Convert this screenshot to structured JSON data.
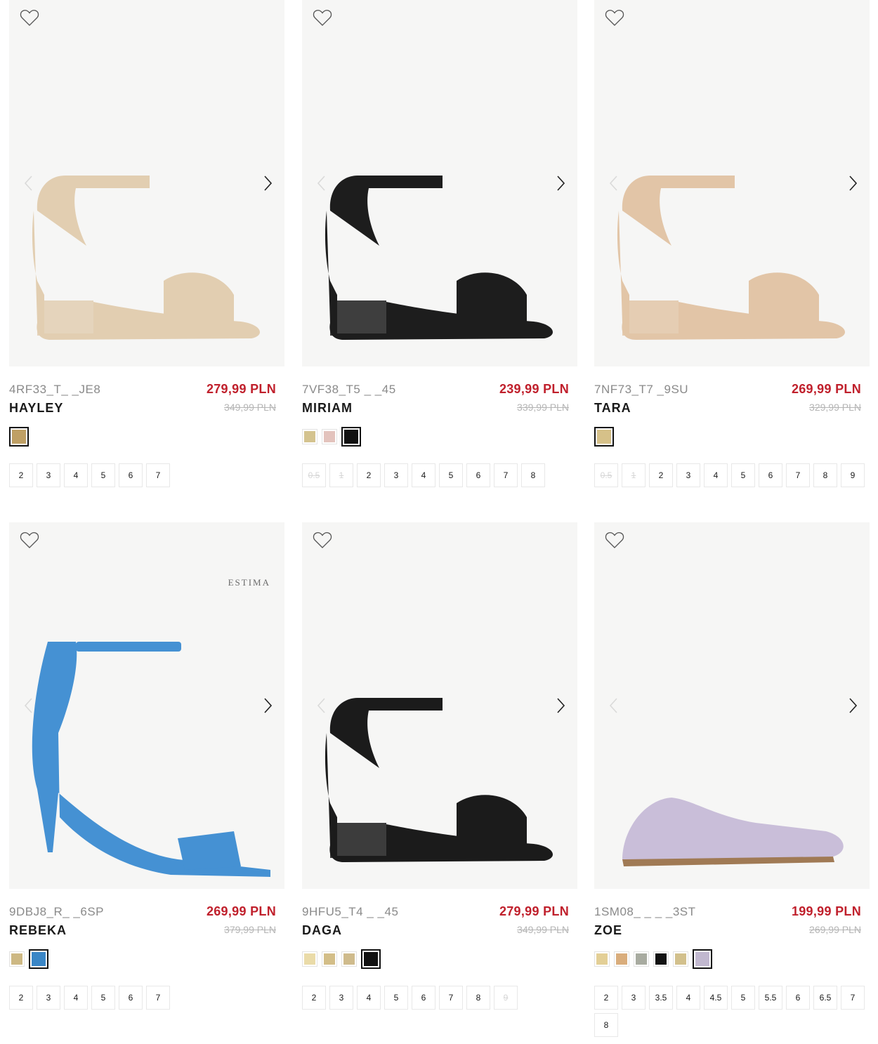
{
  "products": [
    {
      "sku": "4RF33_T_ _JE8",
      "name": "HAYLEY",
      "price": "279,99 PLN",
      "old_price": "349,99 PLN",
      "swatches": [
        {
          "color": "#bfa065",
          "selected": true
        }
      ],
      "sizes": [
        {
          "label": "2"
        },
        {
          "label": "3"
        },
        {
          "label": "4"
        },
        {
          "label": "5"
        },
        {
          "label": "6"
        },
        {
          "label": "7"
        }
      ],
      "shoe_color": "#e2ceb1",
      "watermark": ""
    },
    {
      "sku": "7VF38_T5 _ _45",
      "name": "MIRIAM",
      "price": "239,99 PLN",
      "old_price": "339,99 PLN",
      "swatches": [
        {
          "color": "#d4c38f",
          "selected": false
        },
        {
          "color": "#e3c3bd",
          "selected": false
        },
        {
          "color": "#111111",
          "selected": true
        }
      ],
      "sizes": [
        {
          "label": "0.5",
          "na": true
        },
        {
          "label": "1",
          "na": true
        },
        {
          "label": "2"
        },
        {
          "label": "3"
        },
        {
          "label": "4"
        },
        {
          "label": "5"
        },
        {
          "label": "6"
        },
        {
          "label": "7"
        },
        {
          "label": "8"
        }
      ],
      "shoe_color": "#1d1d1d",
      "watermark": ""
    },
    {
      "sku": "7NF73_T7 _9SU",
      "name": "TARA",
      "price": "269,99 PLN",
      "old_price": "329,99 PLN",
      "swatches": [
        {
          "color": "#d6c189",
          "selected": true
        }
      ],
      "sizes": [
        {
          "label": "0.5",
          "na": true
        },
        {
          "label": "1",
          "na": true
        },
        {
          "label": "2"
        },
        {
          "label": "3"
        },
        {
          "label": "4"
        },
        {
          "label": "5"
        },
        {
          "label": "6"
        },
        {
          "label": "7"
        },
        {
          "label": "8"
        },
        {
          "label": "9"
        }
      ],
      "shoe_color": "#e2c5a7",
      "watermark": ""
    },
    {
      "sku": "9DBJ8_R_ _6SP",
      "name": "REBEKA",
      "price": "269,99 PLN",
      "old_price": "379,99 PLN",
      "swatches": [
        {
          "color": "#cdb883",
          "selected": false
        },
        {
          "color": "#3a86c6",
          "selected": true
        }
      ],
      "sizes": [
        {
          "label": "2"
        },
        {
          "label": "3"
        },
        {
          "label": "4"
        },
        {
          "label": "5"
        },
        {
          "label": "6"
        },
        {
          "label": "7"
        }
      ],
      "shoe_color": "#4591d3",
      "watermark": "ESTIMA"
    },
    {
      "sku": "9HFU5_T4 _ _45",
      "name": "DAGA",
      "price": "279,99 PLN",
      "old_price": "349,99 PLN",
      "swatches": [
        {
          "color": "#eadba8",
          "selected": false
        },
        {
          "color": "#d3be88",
          "selected": false
        },
        {
          "color": "#cfbb8c",
          "selected": false
        },
        {
          "color": "#111111",
          "selected": true
        }
      ],
      "sizes": [
        {
          "label": "2"
        },
        {
          "label": "3"
        },
        {
          "label": "4"
        },
        {
          "label": "5"
        },
        {
          "label": "6"
        },
        {
          "label": "7"
        },
        {
          "label": "8"
        },
        {
          "label": "9",
          "na": true
        }
      ],
      "shoe_color": "#1b1b1b",
      "watermark": ""
    },
    {
      "sku": "1SM08_ _ _ _3ST",
      "name": "ZOE",
      "price": "199,99 PLN",
      "old_price": "269,99 PLN",
      "swatches": [
        {
          "color": "#e3cf96",
          "selected": false
        },
        {
          "color": "#d9ad7c",
          "selected": false
        },
        {
          "color": "#a8aba0",
          "selected": false
        },
        {
          "color": "#121212",
          "selected": false
        },
        {
          "color": "#d2c08c",
          "selected": false
        },
        {
          "color": "#c1b8cf",
          "selected": true
        }
      ],
      "sizes": [
        {
          "label": "2"
        },
        {
          "label": "3"
        },
        {
          "label": "3.5"
        },
        {
          "label": "4"
        },
        {
          "label": "4.5"
        },
        {
          "label": "5"
        },
        {
          "label": "5.5"
        },
        {
          "label": "6"
        },
        {
          "label": "6.5"
        },
        {
          "label": "7"
        },
        {
          "label": "8"
        }
      ],
      "shoe_color": "#c9bed9",
      "watermark": ""
    }
  ]
}
